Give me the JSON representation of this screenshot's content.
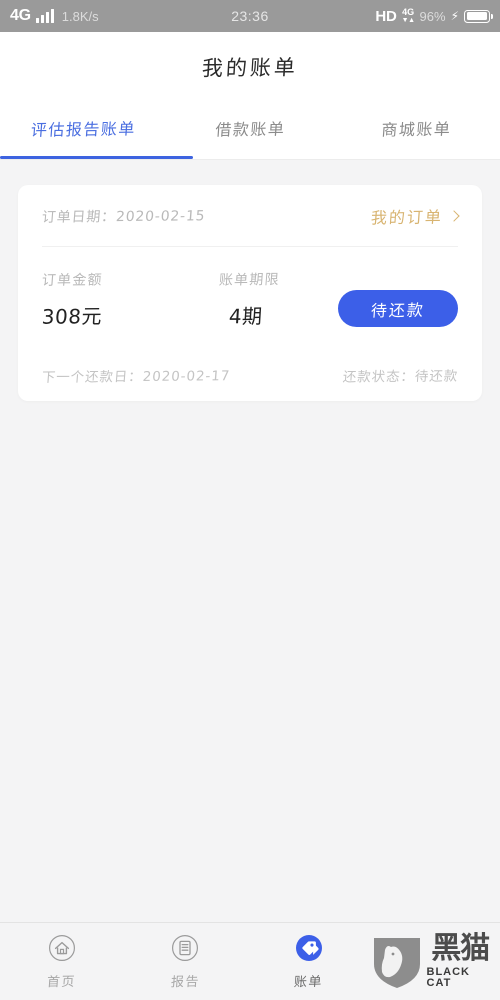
{
  "status_bar": {
    "network_type": "4G",
    "signal_icon": "signal-bars-icon",
    "data_speed": "1.8K/s",
    "time": "23:36",
    "hd_label": "HD",
    "volte_label": "4G",
    "data_arrows": "▼▲",
    "battery_percent": "96%",
    "charging_icon": "lightning-bolt-icon",
    "battery_icon": "battery-icon"
  },
  "header": {
    "title": "我的账单"
  },
  "tabs": [
    {
      "label": "评估报告账单",
      "active": true
    },
    {
      "label": "借款账单",
      "active": false
    },
    {
      "label": "商城账单",
      "active": false
    }
  ],
  "bill_card": {
    "order_date_text": "订单日期：2020-02-15",
    "my_orders_label": "我的订单",
    "my_orders_chevron": "chevron-right-icon",
    "amount_label": "订单金额",
    "amount_value": "308元",
    "term_label": "账单期限",
    "term_value": "4期",
    "repay_button_label": "待还款",
    "next_repay_text": "下一个还款日：2020-02-17",
    "repay_status_text": "还款状态：待还款"
  },
  "bottom_nav": [
    {
      "label": "首页",
      "icon": "home-circle-icon",
      "active": false
    },
    {
      "label": "报告",
      "icon": "document-circle-icon",
      "active": false
    },
    {
      "label": "账单",
      "icon": "price-tag-circle-icon",
      "active": true
    }
  ],
  "watermark": {
    "shield_icon": "cat-shield-icon",
    "cn_text": "黑猫",
    "en_text": "BLACK CAT"
  },
  "colors": {
    "accent_blue": "#3c5fe8",
    "tab_active_blue": "#4a6ee0",
    "gold_link": "#d8b471",
    "page_bg": "#f4f4f5",
    "status_bar_bg": "#9a9a9a"
  }
}
